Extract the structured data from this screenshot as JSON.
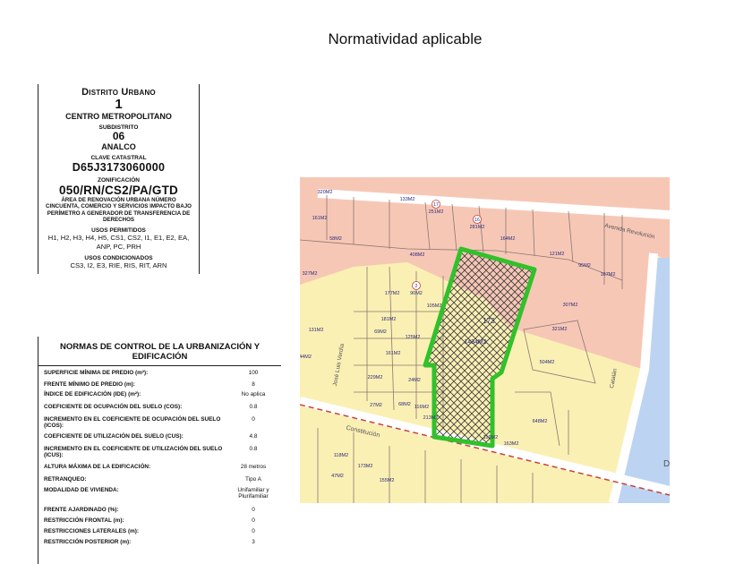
{
  "page": {
    "title": "Normatividad aplicable"
  },
  "district": {
    "heading": "Distrito Urbano",
    "number": "1",
    "name": "CENTRO METROPOLITANO",
    "subdistrito_label": "SUBDISTRITO",
    "subdistrito_number": "06",
    "subdistrito_name": "ANALCO",
    "clave_label": "CLAVE CATASTRAL",
    "clave_value": "D65J3173060000",
    "zonificacion_label": "ZONIFICACIÓN",
    "zonificacion_value": "050/RN/CS2/PA/GTD",
    "zonificacion_desc": "ÁREA DE RENOVACIÓN URBANA NÚMERO CINCUENTA, COMERCIO Y SERVICIOS IMPACTO BAJO PERÍMETRO A GENERADOR DE TRANSFERENCIA DE DERECHOS",
    "usos_permitidos_label": "USOS PERMITIDOS",
    "usos_permitidos": "H1, H2, H3, H4, H5, CS1, CS2, I1, E1, E2, EA, ANP, PC, PRH",
    "usos_condicionados_label": "USOS CONDICIONADOS",
    "usos_condicionados": "CS3, I2, E3, RIE, RIS, RIT, ARN"
  },
  "norms": {
    "title": "NORMAS DE CONTROL DE LA URBANIZACIÓN Y EDIFICACIÓN",
    "rows": [
      {
        "label": "SUPERFICIE MÍNIMA DE PREDIO (m²):",
        "value": "100"
      },
      {
        "label": "FRENTE MÍNIMO DE PREDIO (m):",
        "value": "8"
      },
      {
        "label": "ÍNDICE DE EDIFICACIÓN (IDE) (m²):",
        "value": "No aplica"
      },
      {
        "label": "COEFICIENTE DE OCUPACIÓN DEL SUELO (COS):",
        "value": "0.8"
      },
      {
        "label": "INCREMENTO EN EL COEFICIENTE DE OCUPACIÓN DEL SUELO (ICOS):",
        "value": "0"
      },
      {
        "label": "COEFICIENTE DE UTILIZACIÓN DEL SUELO (CUS):",
        "value": "4.8"
      },
      {
        "label": "INCREMENTO EN EL COEFICIENTE DE UTILIZACIÓN DEL SUELO (ICUS):",
        "value": "0.8"
      },
      {
        "label": "ALTURA MÁXIMA DE LA EDIFICACIÓN:",
        "value": "28 metros"
      },
      {
        "label": "RETRANQUEO:",
        "value": "Tipo A"
      },
      {
        "label": "MODALIDAD DE VIVIENDA:",
        "value": "Unifamiliar y Plurifamiliar"
      },
      {
        "label": "FRENTE AJARDINADO (%):",
        "value": "0"
      },
      {
        "label": "RESTRICCIÓN FRONTAL (m):",
        "value": "0"
      },
      {
        "label": "RESTRICCIONES LATERALES (m):",
        "value": "0"
      },
      {
        "label": "RESTRICCIÓN POSTERIOR (m):",
        "value": "3"
      }
    ]
  },
  "map": {
    "colors": {
      "commercial": "#f7c7b6",
      "residential": "#fbf0b4",
      "water": "#bcd3f2",
      "highlight": "#31c12b",
      "parcel_line": "#8a7772",
      "label": "#2a2a7a",
      "dash": "#c9403a"
    },
    "streets": [
      "Avenida Revolución",
      "José Luis Verdía",
      "Constitución",
      "Catalán"
    ],
    "edge_label": "D",
    "subject_lot": {
      "number": "173",
      "area": "1434M2"
    },
    "lots": [
      {
        "n": "",
        "a": "320M2"
      },
      {
        "n": "",
        "a": "133M2"
      },
      {
        "n": "17",
        "a": "251M2"
      },
      {
        "n": "",
        "a": "161M2"
      },
      {
        "n": "",
        "a": "58M2"
      },
      {
        "n": "",
        "a": ""
      },
      {
        "n": "16",
        "a": "281M2"
      },
      {
        "n": "",
        "a": "164M2"
      },
      {
        "n": "",
        "a": ""
      },
      {
        "n": "",
        "a": ""
      },
      {
        "n": "",
        "a": "121M2"
      },
      {
        "n": "",
        "a": "95M2"
      },
      {
        "n": "",
        "a": "167M2"
      },
      {
        "n": "",
        "a": "408M2"
      },
      {
        "n": "",
        "a": "327M2"
      },
      {
        "n": "",
        "a": "177M2"
      },
      {
        "n": "2",
        "a": "90M2"
      },
      {
        "n": "",
        "a": "105M2"
      },
      {
        "n": "",
        "a": "307M2"
      },
      {
        "n": "",
        "a": "131M2"
      },
      {
        "n": "",
        "a": "181M2"
      },
      {
        "n": "",
        "a": "69M2"
      },
      {
        "n": "",
        "a": "125M2"
      },
      {
        "n": "",
        "a": "321M2"
      },
      {
        "n": "",
        "a": "161M2"
      },
      {
        "n": "",
        "a": "44M2"
      },
      {
        "n": "",
        "a": "504M2"
      },
      {
        "n": "",
        "a": "229M2"
      },
      {
        "n": "",
        "a": "24M2"
      },
      {
        "n": "",
        "a": "27M2"
      },
      {
        "n": "",
        "a": "68M2"
      },
      {
        "n": "",
        "a": "116M2"
      },
      {
        "n": "",
        "a": "213M2"
      },
      {
        "n": "",
        "a": "648M2"
      },
      {
        "n": "",
        "a": "119M2"
      },
      {
        "n": "",
        "a": "163M2"
      },
      {
        "n": "",
        "a": "118M2"
      },
      {
        "n": "",
        "a": "173M2"
      },
      {
        "n": "",
        "a": "47M2"
      },
      {
        "n": "",
        "a": "155M2"
      }
    ]
  }
}
